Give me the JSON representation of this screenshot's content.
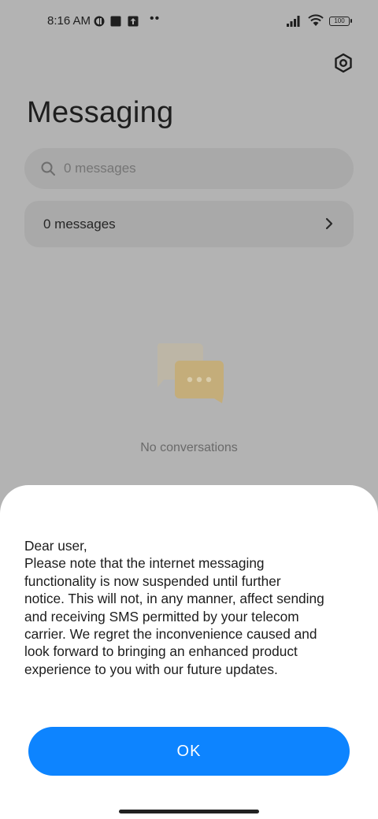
{
  "status_bar": {
    "time": "8:16 AM",
    "battery": "100",
    "icons": [
      "app-notification-icon",
      "square-notification-icon",
      "upload-icon",
      "more-dots-icon",
      "signal-icon",
      "wifi-icon",
      "battery-icon"
    ],
    "more": "••"
  },
  "header": {
    "title": "Messaging",
    "settings_icon": "settings-icon"
  },
  "search": {
    "placeholder": "0 messages"
  },
  "message_row": {
    "label": "0 messages"
  },
  "empty_state": {
    "text": "No conversations",
    "icon": "chat-bubbles-icon"
  },
  "dialog": {
    "lines": [
      "Dear user,",
      "Please note that the internet messaging",
      "functionality is now suspended until further",
      "notice. This will not, in any manner, affect sending",
      "and receiving SMS permitted by your telecom",
      "carrier. We regret the inconvenience caused and",
      "look forward to bringing an enhanced product",
      "experience to you with our future updates."
    ],
    "ok_label": "OK"
  },
  "colors": {
    "accent": "#0d84ff",
    "dim_background": "#b3b3b3",
    "sheet": "#ffffff"
  }
}
